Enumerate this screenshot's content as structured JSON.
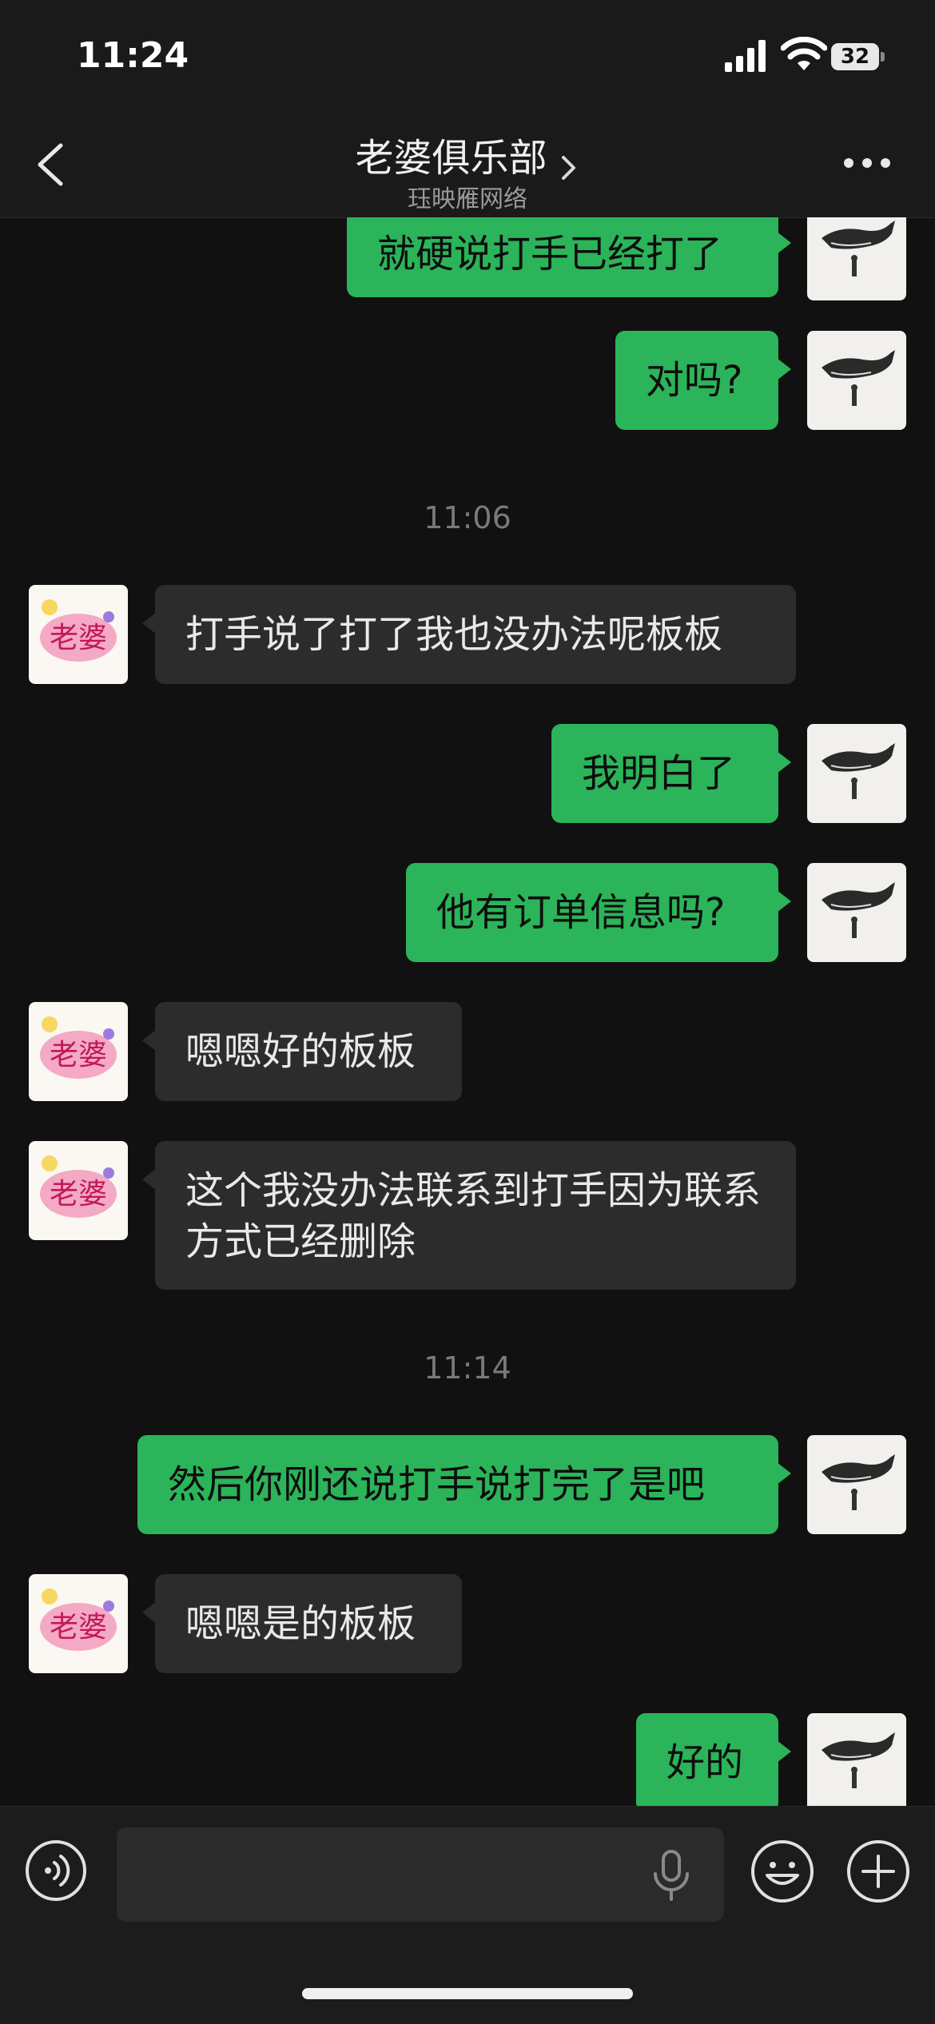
{
  "status": {
    "time": "11:24",
    "battery": "32"
  },
  "header": {
    "title": "老婆俱乐部",
    "subtitle": "珏映雁网络"
  },
  "messages": [
    {
      "side": "me",
      "text": "就硬说打手已经打了"
    },
    {
      "side": "me",
      "text": "对吗?"
    },
    {
      "timestamp": "11:06"
    },
    {
      "side": "them",
      "text": "打手说了打了我也没办法呢板板"
    },
    {
      "side": "me",
      "text": "我明白了"
    },
    {
      "side": "me",
      "text": "他有订单信息吗?"
    },
    {
      "side": "them",
      "text": "嗯嗯好的板板"
    },
    {
      "side": "them",
      "text": "这个我没办法联系到打手因为联系方式已经删除"
    },
    {
      "timestamp": "11:14"
    },
    {
      "side": "me",
      "text": "然后你刚还说打手说打完了是吧"
    },
    {
      "side": "them",
      "text": "嗯嗯是的板板"
    },
    {
      "side": "me",
      "text": "好的"
    }
  ],
  "input": {
    "value": "",
    "placeholder": ""
  },
  "avatars": {
    "me": "whale-avatar",
    "them": "laopo-logo-avatar"
  },
  "colors": {
    "background": "#111111",
    "my_bubble": "#2bb45a",
    "their_bubble": "#2c2c2c",
    "bar": "#1a1a1a"
  }
}
